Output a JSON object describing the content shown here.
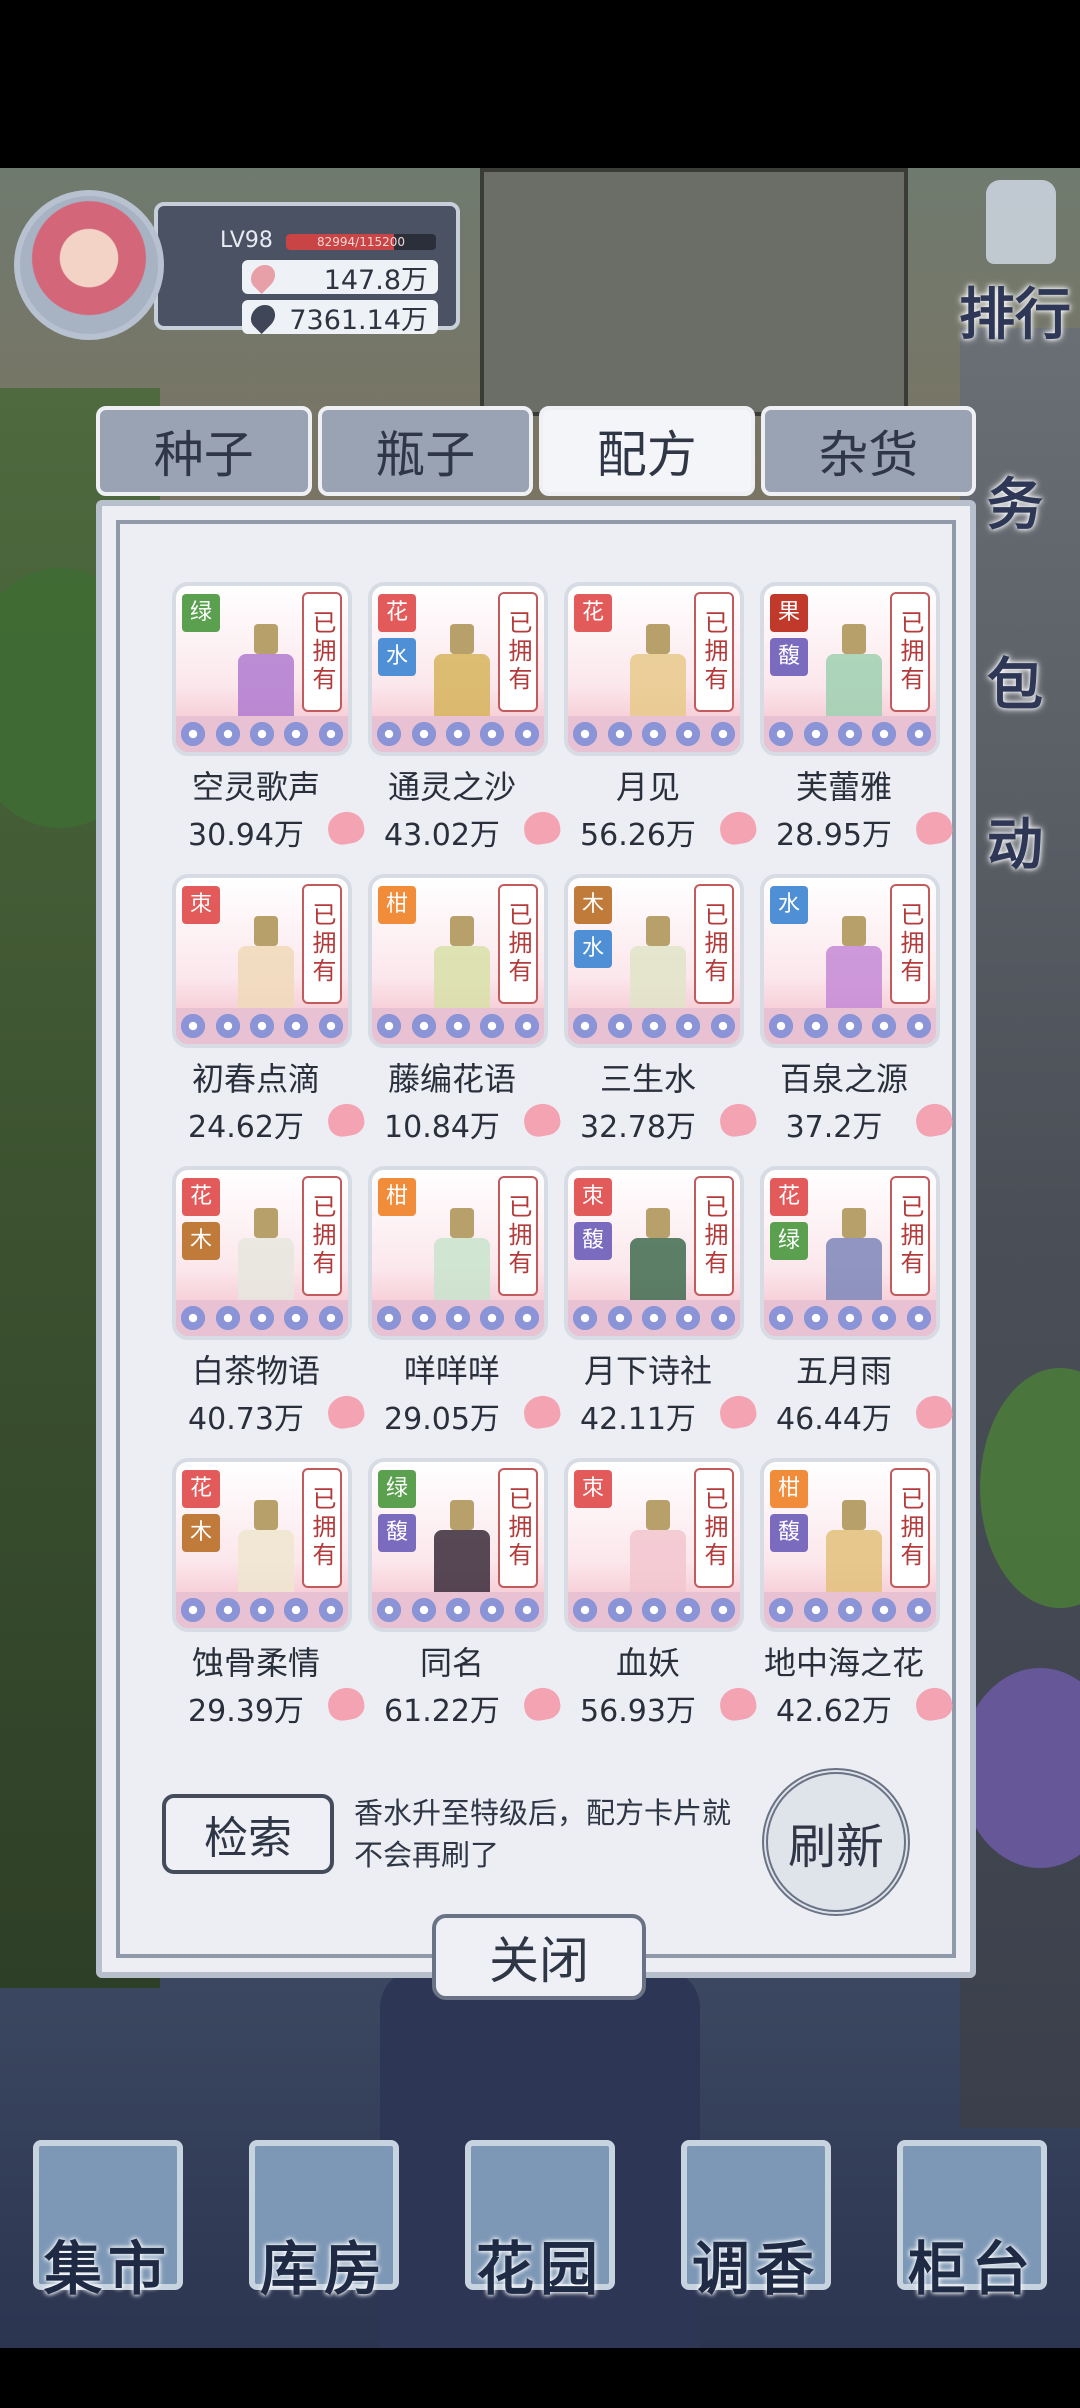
{
  "player": {
    "level": "LV98",
    "xp_text": "82994/115200",
    "xp_fraction": 0.72,
    "currency1": "147.8万",
    "currency2": "7361.14万"
  },
  "side_menu": [
    "排行",
    "务",
    "包",
    "动"
  ],
  "tabs": [
    {
      "label": "种子",
      "active": false
    },
    {
      "label": "瓶子",
      "active": false
    },
    {
      "label": "配方",
      "active": true
    },
    {
      "label": "杂货",
      "active": false
    }
  ],
  "owned_label": "已拥有",
  "recipes": [
    {
      "name": "空灵歌声",
      "value": "30.94万",
      "tags": [
        {
          "t": "绿",
          "c": "#5aa04f"
        }
      ],
      "bottle": "#b07ad0"
    },
    {
      "name": "通灵之沙",
      "value": "43.02万",
      "tags": [
        {
          "t": "花",
          "c": "#e35a5a"
        },
        {
          "t": "水",
          "c": "#4f8fd6"
        }
      ],
      "bottle": "#d6b45a"
    },
    {
      "name": "月见",
      "value": "56.26万",
      "tags": [
        {
          "t": "花",
          "c": "#e35a5a"
        }
      ],
      "bottle": "#e8c98a"
    },
    {
      "name": "芙蕾雅",
      "value": "28.95万",
      "tags": [
        {
          "t": "果",
          "c": "#c0392b"
        },
        {
          "t": "馥",
          "c": "#7a6bbf"
        }
      ],
      "bottle": "#9ed0b0"
    },
    {
      "name": "初春点滴",
      "value": "24.62万",
      "tags": [
        {
          "t": "朿",
          "c": "#e35a5a"
        }
      ],
      "bottle": "#f0d9b8"
    },
    {
      "name": "藤编花语",
      "value": "10.84万",
      "tags": [
        {
          "t": "柑",
          "c": "#f08c3a"
        }
      ],
      "bottle": "#d8e0a8"
    },
    {
      "name": "三生水",
      "value": "32.78万",
      "tags": [
        {
          "t": "木",
          "c": "#c07a3a"
        },
        {
          "t": "水",
          "c": "#4f8fd6"
        }
      ],
      "bottle": "#e0e4c8"
    },
    {
      "name": "百泉之源",
      "value": "37.2万",
      "tags": [
        {
          "t": "水",
          "c": "#4f8fd6"
        }
      ],
      "bottle": "#c48ad6"
    },
    {
      "name": "白茶物语",
      "value": "40.73万",
      "tags": [
        {
          "t": "花",
          "c": "#e35a5a"
        },
        {
          "t": "木",
          "c": "#c07a3a"
        }
      ],
      "bottle": "#e6e6de"
    },
    {
      "name": "咩咩咩",
      "value": "29.05万",
      "tags": [
        {
          "t": "柑",
          "c": "#f08c3a"
        }
      ],
      "bottle": "#c8e4cc"
    },
    {
      "name": "月下诗社",
      "value": "42.11万",
      "tags": [
        {
          "t": "朿",
          "c": "#e35a5a"
        },
        {
          "t": "馥",
          "c": "#7a6bbf"
        }
      ],
      "bottle": "#3f6b4f"
    },
    {
      "name": "五月雨",
      "value": "46.44万",
      "tags": [
        {
          "t": "花",
          "c": "#e35a5a"
        },
        {
          "t": "绿",
          "c": "#5aa04f"
        }
      ],
      "bottle": "#7c86b8"
    },
    {
      "name": "蚀骨柔情",
      "value": "29.39万",
      "tags": [
        {
          "t": "花",
          "c": "#e35a5a"
        },
        {
          "t": "木",
          "c": "#c07a3a"
        }
      ],
      "bottle": "#efe6cf"
    },
    {
      "name": "同名",
      "value": "61.22万",
      "tags": [
        {
          "t": "绿",
          "c": "#5aa04f"
        },
        {
          "t": "馥",
          "c": "#7a6bbf"
        }
      ],
      "bottle": "#3a2a3a"
    },
    {
      "name": "血妖",
      "value": "56.93万",
      "tags": [
        {
          "t": "朿",
          "c": "#e35a5a"
        }
      ],
      "bottle": "#f2c6cf"
    },
    {
      "name": "地中海之花",
      "value": "42.62万",
      "tags": [
        {
          "t": "柑",
          "c": "#f08c3a"
        },
        {
          "t": "馥",
          "c": "#7a6bbf"
        }
      ],
      "bottle": "#e3c17a"
    }
  ],
  "search_label": "检索",
  "hint_text": "香水升至特级后，配方卡片就不会再刷了",
  "refresh_label": "刷新",
  "close_label": "关闭",
  "bottom_nav": [
    "集市",
    "库房",
    "花园",
    "调香",
    "柜台"
  ]
}
